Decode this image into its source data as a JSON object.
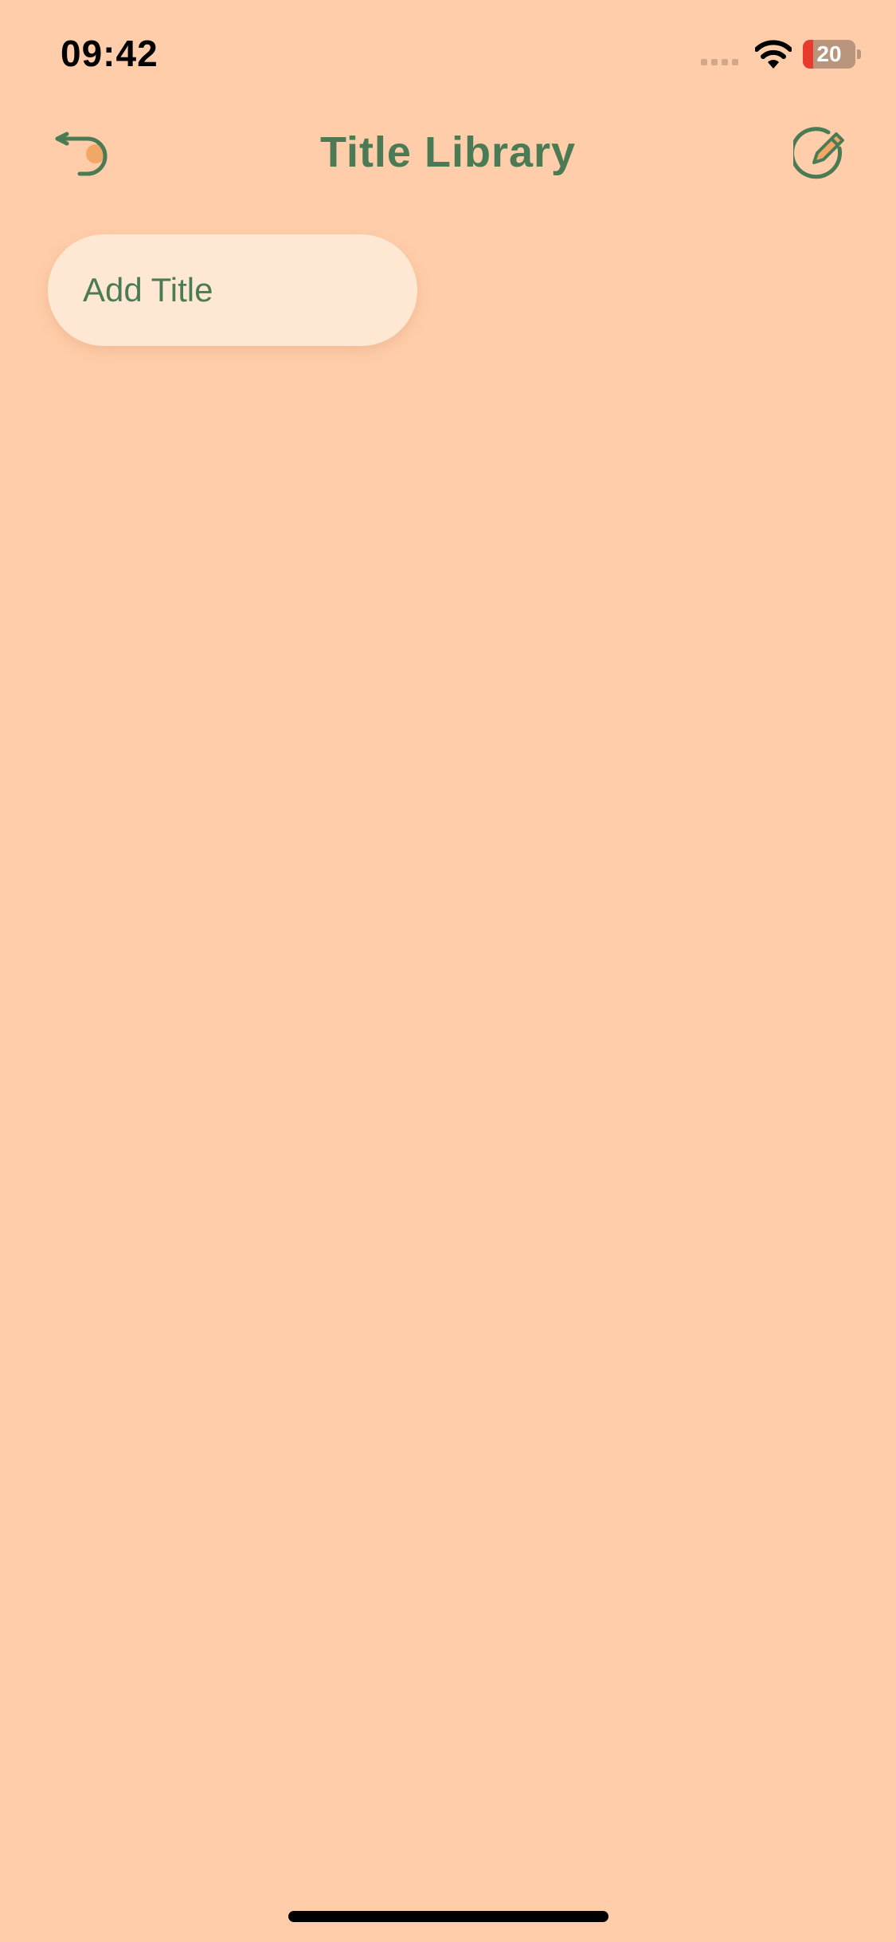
{
  "status_bar": {
    "time": "09:42",
    "battery_level": "20",
    "battery_fraction": 0.2,
    "icons": [
      "cellular-signal-icon",
      "wifi-icon",
      "battery-icon"
    ]
  },
  "header": {
    "title": "Title Library",
    "back_icon": "back-arrow-icon",
    "edit_icon": "edit-pencil-icon"
  },
  "main": {
    "add_title_label": "Add Title"
  },
  "colors": {
    "background": "#FFCDA9",
    "accent": "#4A7B55",
    "pill_background": "#FFE8D3",
    "battery_low": "#E83B2E",
    "icon_fill": "#F2A766"
  }
}
